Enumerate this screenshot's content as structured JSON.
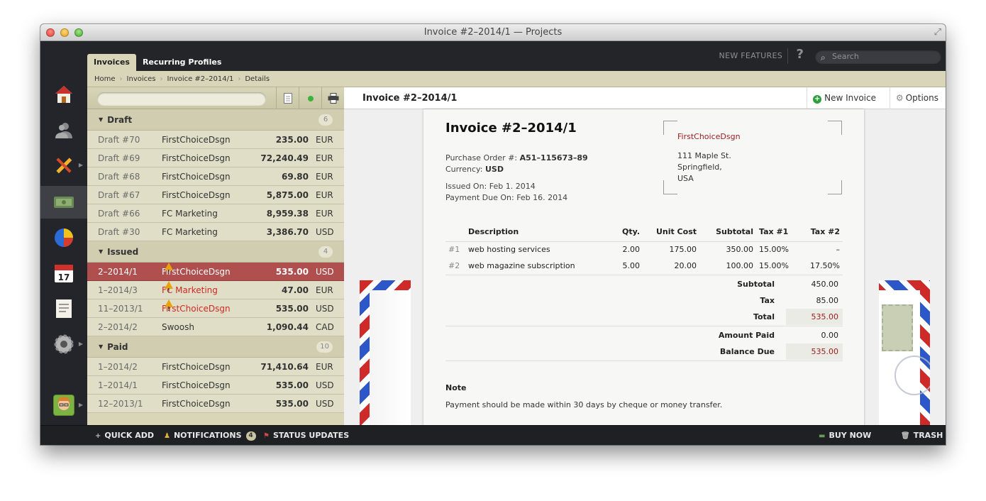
{
  "window": {
    "title": "Invoice #2–2014/1 — Projects"
  },
  "top": {
    "tabs": [
      {
        "label": "Invoices"
      },
      {
        "label": "Recurring Profiles"
      }
    ],
    "new_features": "NEW FEATURES",
    "help": "?",
    "search_placeholder": "Search"
  },
  "breadcrumbs": [
    "Home",
    "Invoices",
    "Invoice #2–2014/1",
    "Details"
  ],
  "sidebar": {
    "icons": [
      "home-icon",
      "contacts-icon",
      "projects-icon",
      "invoices-icon",
      "reports-icon",
      "calendar-icon",
      "documents-icon",
      "settings-icon"
    ],
    "calendar_day": "17"
  },
  "list": {
    "groups": [
      {
        "name": "Draft",
        "count": "6",
        "rows": [
          {
            "id": "Draft #70",
            "client": "FirstChoiceDsgn",
            "amount": "235.00",
            "currency": "EUR"
          },
          {
            "id": "Draft #69",
            "client": "FirstChoiceDsgn",
            "amount": "72,240.49",
            "currency": "EUR"
          },
          {
            "id": "Draft #68",
            "client": "FirstChoiceDsgn",
            "amount": "69.80",
            "currency": "EUR"
          },
          {
            "id": "Draft #67",
            "client": "FirstChoiceDsgn",
            "amount": "5,875.00",
            "currency": "EUR"
          },
          {
            "id": "Draft #66",
            "client": "FC Marketing",
            "amount": "8,959.38",
            "currency": "EUR"
          },
          {
            "id": "Draft #30",
            "client": "FC Marketing",
            "amount": "3,386.70",
            "currency": "USD"
          }
        ]
      },
      {
        "name": "Issued",
        "count": "4",
        "rows": [
          {
            "id": "2–2014/1",
            "client": "FirstChoiceDsgn",
            "amount": "535.00",
            "currency": "USD"
          },
          {
            "id": "1–2014/3",
            "client": "FC Marketing",
            "amount": "47.00",
            "currency": "EUR"
          },
          {
            "id": "11–2013/1",
            "client": "FirstChoiceDsgn",
            "amount": "535.00",
            "currency": "USD"
          },
          {
            "id": "2–2014/2",
            "client": "Swoosh",
            "amount": "1,090.44",
            "currency": "CAD"
          }
        ]
      },
      {
        "name": "Paid",
        "count": "10",
        "rows": [
          {
            "id": "1–2014/2",
            "client": "FirstChoiceDsgn",
            "amount": "71,410.64",
            "currency": "EUR"
          },
          {
            "id": "1–2014/1",
            "client": "FirstChoiceDsgn",
            "amount": "535.00",
            "currency": "USD"
          },
          {
            "id": "12–2013/1",
            "client": "FirstChoiceDsgn",
            "amount": "535.00",
            "currency": "USD"
          }
        ]
      }
    ]
  },
  "detail": {
    "title": "Invoice #2–2014/1",
    "new_invoice": "New Invoice",
    "options": "Options"
  },
  "invoice": {
    "title": "Invoice #2–2014/1",
    "po_label": "Purchase Order #:",
    "po_value": "A51–115673–89",
    "currency_label": "Currency:",
    "currency_value": "USD",
    "issued": "Issued On: Feb 1. 2014",
    "due": "Payment Due On: Feb 16. 2014",
    "client": "FirstChoiceDsgn",
    "address1": "111 Maple St.",
    "address2": "Springfield,",
    "address3": "USA",
    "columns": [
      "Description",
      "Qty.",
      "Unit Cost",
      "Subtotal",
      "Tax #1",
      "Tax #2"
    ],
    "items": [
      {
        "num": "#1",
        "desc": "web hosting services",
        "qty": "2.00",
        "unit": "175.00",
        "subtotal": "350.00",
        "tax1": "15.00%",
        "tax2": "–"
      },
      {
        "num": "#2",
        "desc": "web magazine subscription",
        "qty": "5.00",
        "unit": "20.00",
        "subtotal": "100.00",
        "tax1": "15.00%",
        "tax2": "17.50%"
      }
    ],
    "totals": {
      "subtotal_label": "Subtotal",
      "subtotal": "450.00",
      "tax_label": "Tax",
      "tax": "85.00",
      "total_label": "Total",
      "total": "535.00",
      "paid_label": "Amount Paid",
      "paid": "0.00",
      "balance_label": "Balance Due",
      "balance": "535.00"
    },
    "note_label": "Note",
    "note": "Payment should be made within 30 days by cheque or money transfer."
  },
  "bottom": {
    "quick_add": "QUICK ADD",
    "notifications": "NOTIFICATIONS",
    "notifications_count": "4",
    "status_updates": "STATUS UPDATES",
    "buy_now": "BUY NOW",
    "trash": "TRASH"
  },
  "colors": {
    "selected_row": "#b0504e",
    "accent_red": "#9b1c1c",
    "panel": "#d8d5b8"
  }
}
